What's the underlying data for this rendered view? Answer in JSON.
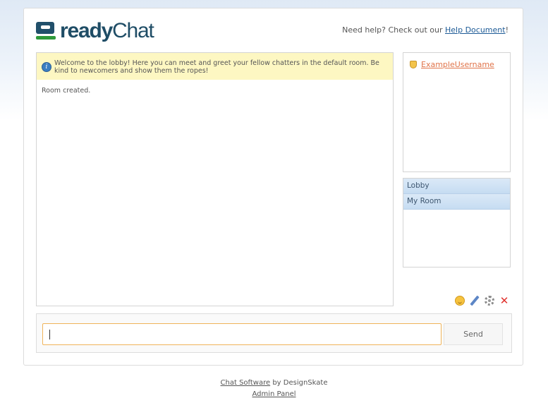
{
  "header": {
    "logo_ready": "ready",
    "logo_chat": "Chat",
    "help_text": "Need help? Check out our ",
    "help_link": "Help Document",
    "help_suffix": "!"
  },
  "chat": {
    "notice": "Welcome to the lobby! Here you can meet and greet your fellow chatters in the default room. Be kind to newcomers and show them the ropes!",
    "messages": [
      "Room created."
    ]
  },
  "users": [
    {
      "name": "ExampleUsername",
      "icon": "shield-icon"
    }
  ],
  "rooms": [
    "Lobby",
    "My Room"
  ],
  "toolbar": {
    "icons": [
      "smiley-icon",
      "pen-icon",
      "gear-icon",
      "close-icon"
    ]
  },
  "composer": {
    "input_value": "",
    "send_label": "Send"
  },
  "footer": {
    "software_link": "Chat Software",
    "by_text": " by DesignSkate",
    "admin_link": "Admin Panel"
  },
  "colors": {
    "brand": "#1f4d66",
    "accent_green": "#2f9a3b",
    "notice_bg": "#fdf7c2",
    "username": "#e0744a",
    "input_focus": "#f0b45a"
  }
}
